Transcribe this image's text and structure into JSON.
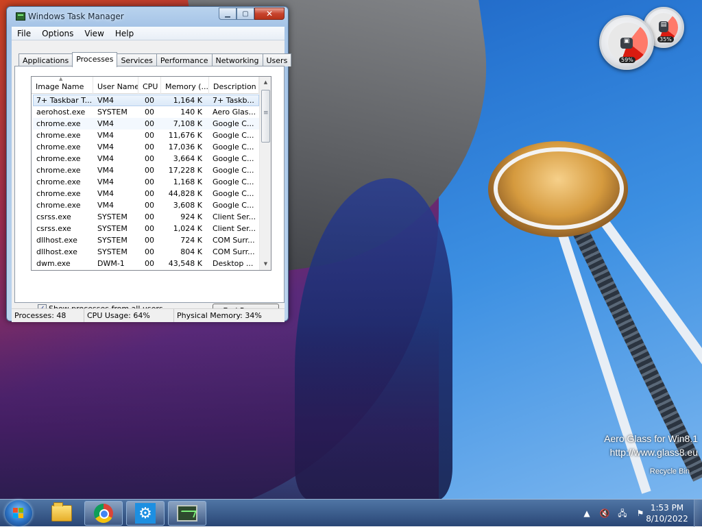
{
  "window": {
    "title": "Windows Task Manager",
    "menu": [
      "File",
      "Options",
      "View",
      "Help"
    ],
    "tabs": [
      "Applications",
      "Processes",
      "Services",
      "Performance",
      "Networking",
      "Users"
    ],
    "active_tab": "Processes",
    "columns": [
      "Image Name",
      "User Name",
      "CPU",
      "Memory (...",
      "Description"
    ],
    "processes": [
      {
        "name": "7+ Taskbar T...",
        "user": "VM4",
        "cpu": "00",
        "mem": "1,164 K",
        "desc": "7+ Taskb..."
      },
      {
        "name": "aerohost.exe",
        "user": "SYSTEM",
        "cpu": "00",
        "mem": "140 K",
        "desc": "Aero Glas..."
      },
      {
        "name": "chrome.exe",
        "user": "VM4",
        "cpu": "00",
        "mem": "7,108 K",
        "desc": "Google C..."
      },
      {
        "name": "chrome.exe",
        "user": "VM4",
        "cpu": "00",
        "mem": "11,676 K",
        "desc": "Google C..."
      },
      {
        "name": "chrome.exe",
        "user": "VM4",
        "cpu": "00",
        "mem": "17,036 K",
        "desc": "Google C..."
      },
      {
        "name": "chrome.exe",
        "user": "VM4",
        "cpu": "00",
        "mem": "3,664 K",
        "desc": "Google C..."
      },
      {
        "name": "chrome.exe",
        "user": "VM4",
        "cpu": "00",
        "mem": "17,228 K",
        "desc": "Google C..."
      },
      {
        "name": "chrome.exe",
        "user": "VM4",
        "cpu": "00",
        "mem": "1,168 K",
        "desc": "Google C..."
      },
      {
        "name": "chrome.exe",
        "user": "VM4",
        "cpu": "00",
        "mem": "44,828 K",
        "desc": "Google C..."
      },
      {
        "name": "chrome.exe",
        "user": "VM4",
        "cpu": "00",
        "mem": "3,608 K",
        "desc": "Google C..."
      },
      {
        "name": "csrss.exe",
        "user": "SYSTEM",
        "cpu": "00",
        "mem": "924 K",
        "desc": "Client Ser..."
      },
      {
        "name": "csrss.exe",
        "user": "SYSTEM",
        "cpu": "00",
        "mem": "1,024 K",
        "desc": "Client Ser..."
      },
      {
        "name": "dllhost.exe",
        "user": "SYSTEM",
        "cpu": "00",
        "mem": "724 K",
        "desc": "COM Surr..."
      },
      {
        "name": "dllhost.exe",
        "user": "SYSTEM",
        "cpu": "00",
        "mem": "804 K",
        "desc": "COM Surr..."
      },
      {
        "name": "dwm.exe",
        "user": "DWM-1",
        "cpu": "00",
        "mem": "43,548 K",
        "desc": "Desktop ..."
      }
    ],
    "show_all_label": "Show processes from all users",
    "show_all_checked": true,
    "end_process_label": "End Process",
    "status": {
      "processes": "Processes: 48",
      "cpu": "CPU Usage: 64%",
      "memory": "Physical Memory: 34%"
    }
  },
  "gadget": {
    "cpu_readout": "59%",
    "memory_readout": "35%"
  },
  "desktop": {
    "watermark_line1": "Aero Glass for Win8.1",
    "watermark_line2": "http://www.glass8.eu",
    "recycle_bin_label": "Recycle Bin"
  },
  "taskbar": {
    "pinned": [
      "folder-icon",
      "chrome-icon",
      "settings-icon",
      "task-manager-icon"
    ],
    "clock_time": "1:53 PM",
    "clock_date": "8/10/2022"
  },
  "colors": {
    "selection": "#dbe9f8",
    "close_button": "#c7432d",
    "taskbar": "#1e3c6e"
  }
}
